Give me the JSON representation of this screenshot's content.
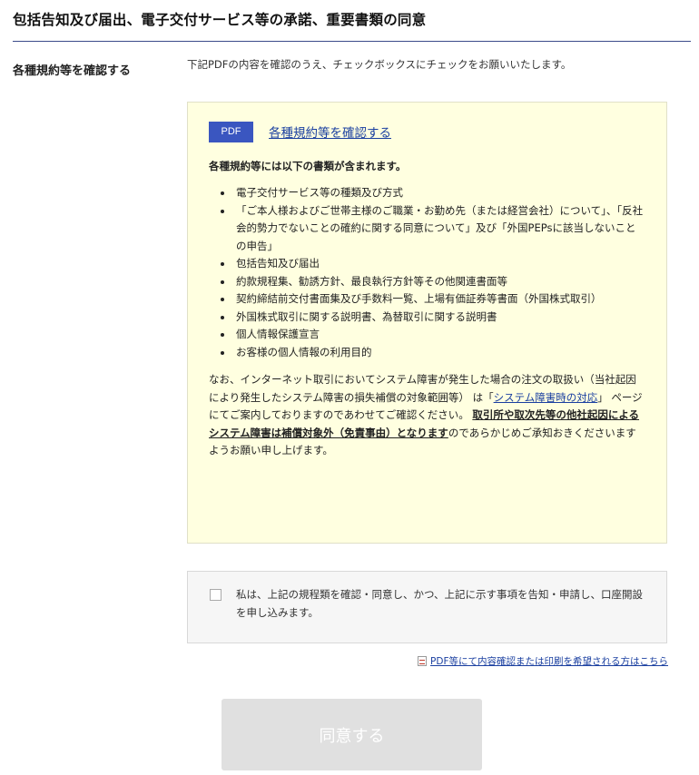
{
  "page": {
    "title": "包括告知及び届出、電子交付サービス等の承諾、重要書類の同意"
  },
  "section": {
    "label": "各種規約等を確認する",
    "intro": "下記PDFの内容を確認のうえ、チェックボックスにチェックをお願いいたします。"
  },
  "pdf_box": {
    "badge": "PDF",
    "link_text": "各種規約等を確認する",
    "includes_heading": "各種規約等には以下の書類が含まれます。",
    "documents": [
      "電子交付サービス等の種類及び方式",
      "「ご本人様およびご世帯主様のご職業・お勤め先（または経営会社）について」、「反社会的勢力でないことの確約に関する同意について」及び「外国PEPsに該当しないことの申告」",
      "包括告知及び届出",
      "約款規程集、勧誘方針、最良執行方針等その他関連書面等",
      "契約締結前交付書面集及び手数料一覧、上場有価証券等書面（外国株式取引）",
      "外国株式取引に関する説明書、為替取引に関する説明書",
      "個人情報保護宣言",
      "お客様の個人情報の利用目的"
    ],
    "notice_part1": "なお、インターネット取引においてシステム障害が発生した場合の注文の取扱い（当社起因により発生したシステム障害の損失補償の対象範囲等） は「",
    "notice_link": "システム障害時の対応",
    "notice_part2": "」 ページにてご案内しておりますのであわせてご確認ください。 ",
    "notice_disclaimer": "取引所や取次先等の他社起因によるシステム障害は補償対象外（免責事由）となります",
    "notice_part3": "のであらかじめご承知おきくださいますようお願い申し上げます。"
  },
  "agreement": {
    "checkbox_label": "私は、上記の規程類を確認・同意し、かつ、上記に示す事項を告知・申請し、口座開設を申し込みます。",
    "checked": false
  },
  "print_link": {
    "icon": "pdf-file-icon",
    "text": "PDF等にて内容確認または印刷を希望される方はこちら"
  },
  "submit": {
    "label": "同意する",
    "enabled": false
  },
  "colors": {
    "accent": "#3a56c0",
    "link": "#1a3fa0",
    "pdf_box_bg": "#ffffe0",
    "button_disabled_bg": "#e0e0e0"
  }
}
